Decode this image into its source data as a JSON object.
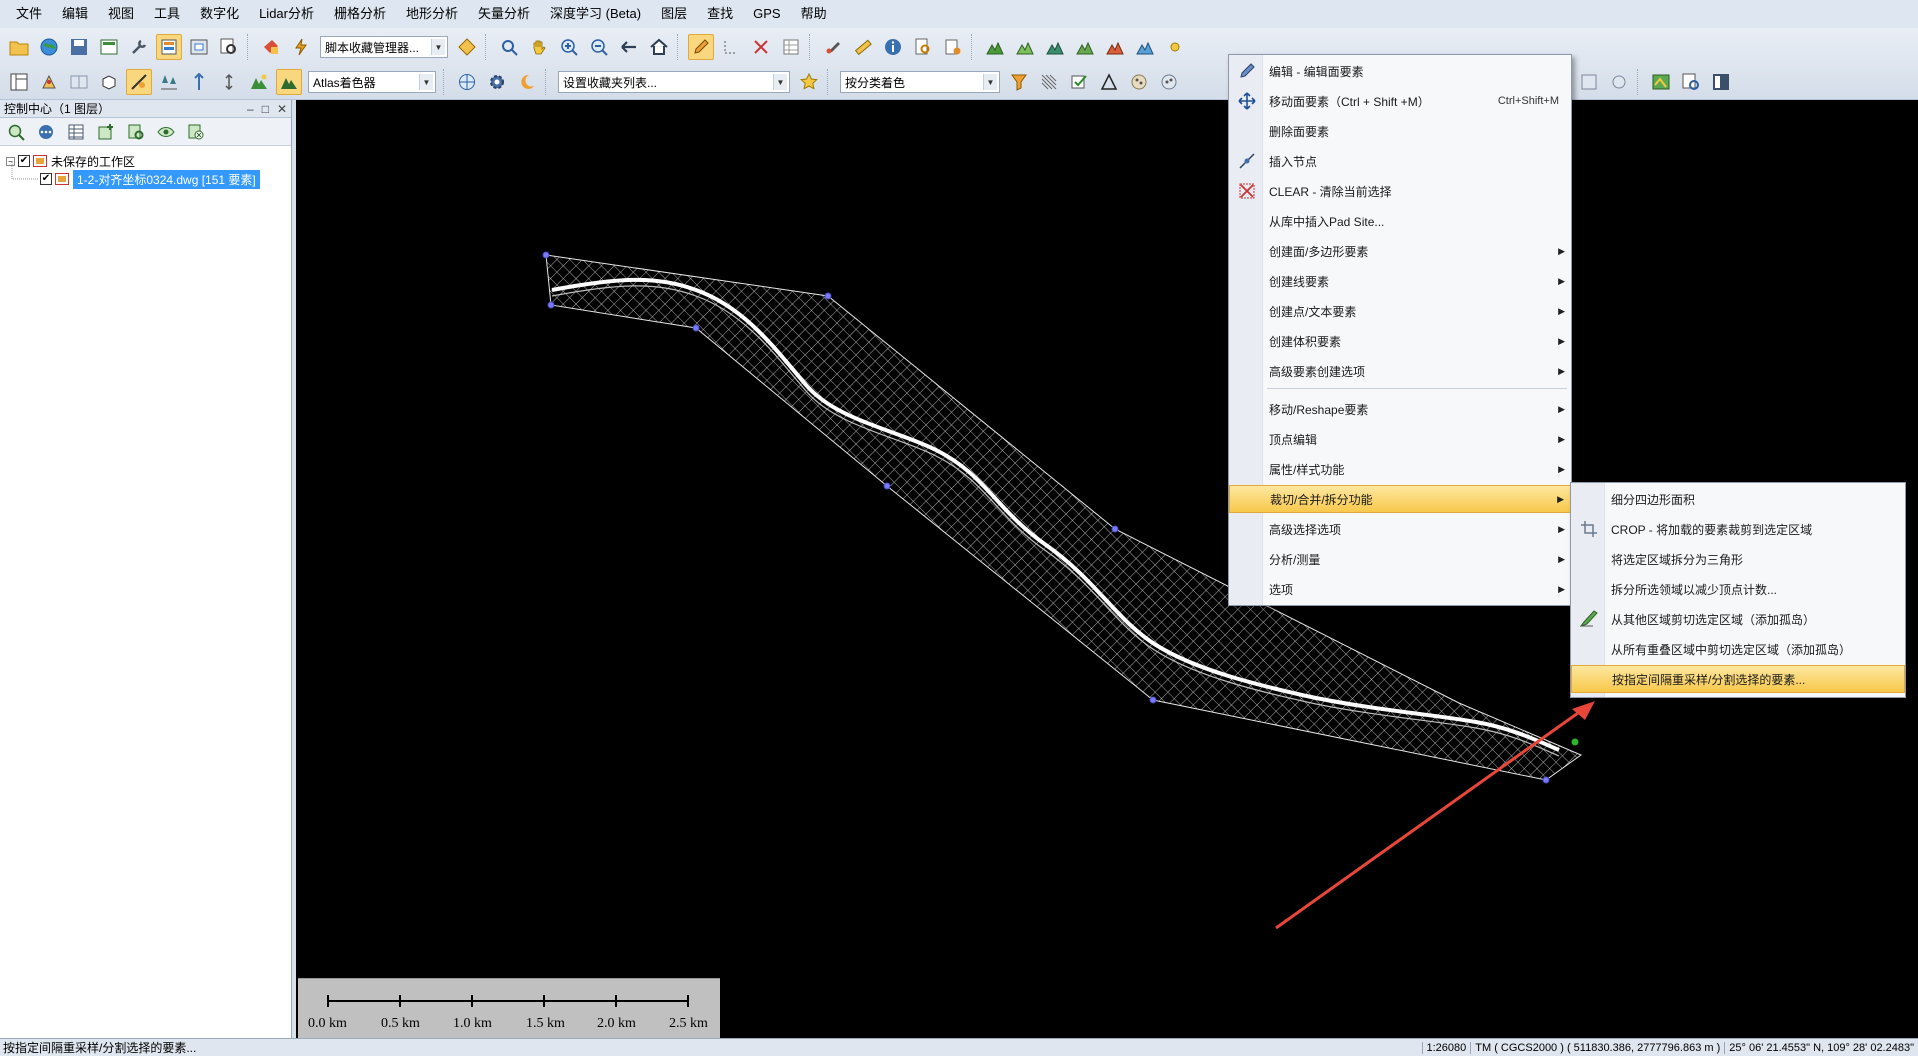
{
  "menubar": [
    "文件",
    "编辑",
    "视图",
    "工具",
    "数字化",
    "Lidar分析",
    "栅格分析",
    "地形分析",
    "矢量分析",
    "深度学习 (Beta)",
    "图层",
    "查找",
    "GPS",
    "帮助"
  ],
  "toolbar": {
    "script_manager": "脚本收藏管理器...",
    "atlas_shader": "Atlas着色器",
    "favorites_list": "设置收藏夹列表...",
    "classify_color": "按分类着色"
  },
  "panel": {
    "title": "控制中心（1 图层）",
    "workspace": "未保存的工作区",
    "layer": "1-2-对齐坐标0324.dwg [151 要素]"
  },
  "context_menu": {
    "items": [
      {
        "label": "编辑 - 编辑面要素",
        "icon": "edit-icon"
      },
      {
        "label": "移动面要素（Ctrl + Shift +M）",
        "shortcut": "Ctrl+Shift+M",
        "icon": "move-icon"
      },
      {
        "label": "删除面要素",
        "icon": ""
      },
      {
        "label": "插入节点",
        "icon": "insert-vertex-icon"
      },
      {
        "label": "CLEAR - 清除当前选择",
        "icon": "clear-icon"
      },
      {
        "label": "从库中插入Pad Site...",
        "icon": ""
      },
      {
        "label": "创建面/多边形要素",
        "sub": true
      },
      {
        "label": "创建线要素",
        "sub": true
      },
      {
        "label": "创建点/文本要素",
        "sub": true
      },
      {
        "label": "创建体积要素",
        "sub": true
      },
      {
        "label": "高级要素创建选项",
        "sub": true
      },
      {
        "label": "移动/Reshape要素",
        "sub": true
      },
      {
        "label": "顶点编辑",
        "sub": true
      },
      {
        "label": "属性/样式功能",
        "sub": true
      },
      {
        "label": "裁切/合并/拆分功能",
        "sub": true,
        "highlight": true
      },
      {
        "label": "高级选择选项",
        "sub": true
      },
      {
        "label": "分析/测量",
        "sub": true
      },
      {
        "label": "选项",
        "sub": true
      }
    ]
  },
  "submenu": {
    "items": [
      {
        "label": "细分四边形面积",
        "icon": ""
      },
      {
        "label": "CROP - 将加载的要素裁剪到选定区域",
        "icon": "crop-icon"
      },
      {
        "label": "将选定区域拆分为三角形",
        "icon": ""
      },
      {
        "label": "拆分所选领域以减少顶点计数...",
        "icon": ""
      },
      {
        "label": "从其他区域剪切选定区域（添加孤岛）",
        "icon": "cut-area-icon"
      },
      {
        "label": "从所有重叠区域中剪切选定区域（添加孤岛）",
        "icon": ""
      },
      {
        "label": "按指定间隔重采样/分割选择的要素...",
        "icon": "",
        "highlight": true
      }
    ]
  },
  "scalebar": [
    "0.0 km",
    "0.5 km",
    "1.0 km",
    "1.5 km",
    "2.0 km",
    "2.5 km"
  ],
  "status": {
    "message": "按指定间隔重采样/分割选择的要素...",
    "scale": "1:26080",
    "projection": "TM ( CGCS2000 ) ( 511830.386, 2777796.863 m )",
    "latlon": "25° 06' 21.4553\" N, 109° 28' 02.2483\""
  },
  "colors": {
    "highlight": "#f8c84a",
    "selection": "#3399ff",
    "annotation_arrow": "#e8463a"
  }
}
